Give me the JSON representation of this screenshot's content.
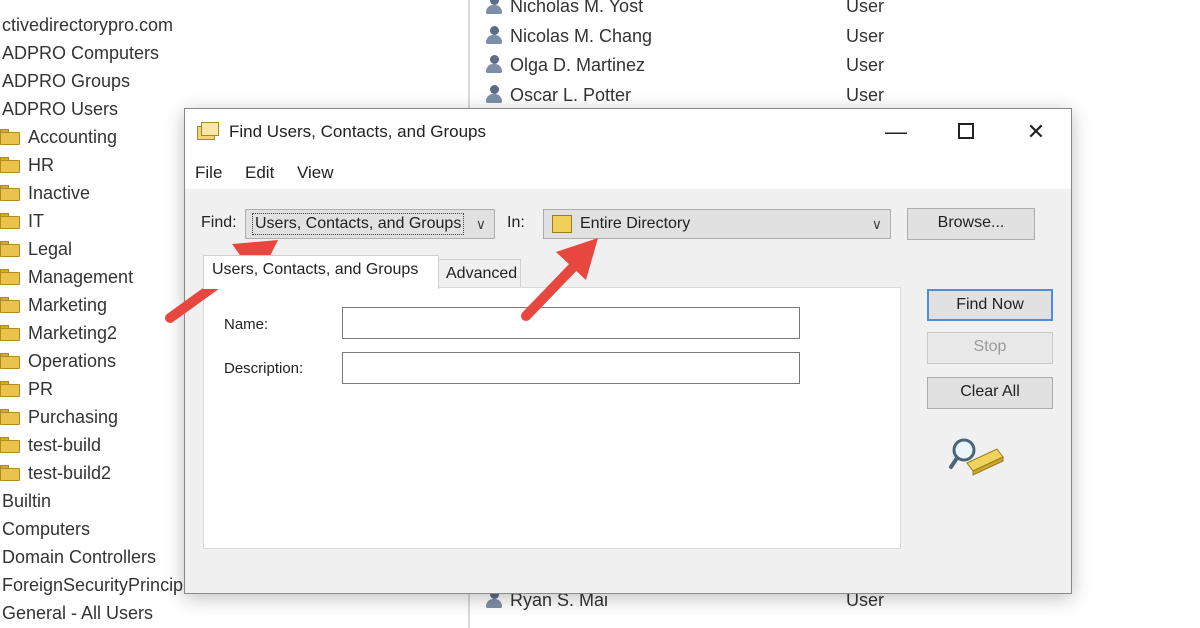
{
  "tree": {
    "items": [
      {
        "label": "ctivedirectorypro.com",
        "folder": false
      },
      {
        "label": "ADPRO Computers",
        "folder": false
      },
      {
        "label": "ADPRO Groups",
        "folder": false
      },
      {
        "label": "ADPRO Users",
        "folder": false
      },
      {
        "label": "Accounting",
        "folder": true
      },
      {
        "label": "HR",
        "folder": true
      },
      {
        "label": "Inactive",
        "folder": true
      },
      {
        "label": "IT",
        "folder": true
      },
      {
        "label": "Legal",
        "folder": true
      },
      {
        "label": "Management",
        "folder": true
      },
      {
        "label": "Marketing",
        "folder": true
      },
      {
        "label": "Marketing2",
        "folder": true
      },
      {
        "label": "Operations",
        "folder": true
      },
      {
        "label": "PR",
        "folder": true
      },
      {
        "label": "Purchasing",
        "folder": true
      },
      {
        "label": "test-build",
        "folder": true
      },
      {
        "label": "test-build2",
        "folder": true
      },
      {
        "label": "Builtin",
        "folder": false
      },
      {
        "label": "Computers",
        "folder": false
      },
      {
        "label": "Domain Controllers",
        "folder": false
      },
      {
        "label": "ForeignSecurityPrincip",
        "folder": false
      },
      {
        "label": "General - All Users",
        "folder": false
      }
    ]
  },
  "list": {
    "rows": [
      {
        "name": "Nicholas M. Yost",
        "type": "User"
      },
      {
        "name": "Nicolas M. Chang",
        "type": "User"
      },
      {
        "name": "Olga D. Martinez",
        "type": "User"
      },
      {
        "name": "Oscar L. Potter",
        "type": "User"
      }
    ],
    "bottom_rows": [
      {
        "name": "Ryan S. Mai",
        "type": "User"
      }
    ]
  },
  "dialog": {
    "title": "Find Users, Contacts, and Groups",
    "window_buttons": {
      "minimize": "—",
      "close": "✕"
    },
    "menu": {
      "file": "File",
      "edit": "Edit",
      "view": "View"
    },
    "find_label": "Find:",
    "find_value": "Users, Contacts, and Groups",
    "in_label": "In:",
    "in_value": "Entire Directory",
    "browse_label": "Browse...",
    "tabs": {
      "users": "Users, Contacts, and Groups",
      "advanced": "Advanced"
    },
    "fields": {
      "name_label": "Name:",
      "name_value": "",
      "description_label": "Description:",
      "description_value": ""
    },
    "buttons": {
      "find_now": "Find Now",
      "stop": "Stop",
      "clear_all": "Clear All"
    }
  },
  "colors": {
    "annotation_arrow": "#e8473f",
    "focus_border": "#4f8fd6"
  }
}
